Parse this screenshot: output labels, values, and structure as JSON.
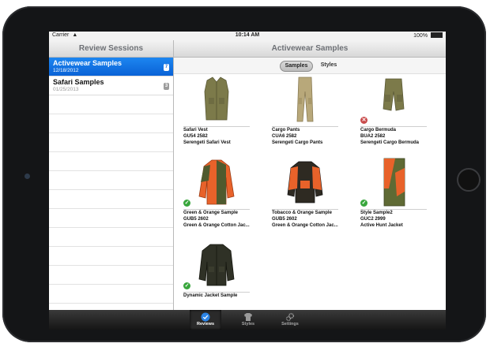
{
  "status": {
    "carrier": "Carrier",
    "time": "10:14 AM",
    "battery": "100%"
  },
  "left_panel": {
    "title": "Review Sessions",
    "sessions": [
      {
        "title": "Activewear Samples",
        "date": "12/18/2012",
        "badge": "7",
        "selected": true
      },
      {
        "title": "Safari Samples",
        "date": "01/25/2013",
        "badge": "3",
        "selected": false
      }
    ]
  },
  "right_panel": {
    "title": "Activewear Samples",
    "segments": [
      {
        "label": "Samples",
        "active": true
      },
      {
        "label": "Styles",
        "active": false
      }
    ],
    "items": [
      {
        "name": "Safari Vest",
        "code": "GU54 2582",
        "desc": "Serengeti Safari Vest",
        "status": "none",
        "image": "vest-icon"
      },
      {
        "name": "Cargo Pants",
        "code": "CUA6 2582",
        "desc": "Serengeti Cargo Pants",
        "status": "none",
        "image": "pants-icon"
      },
      {
        "name": "Cargo Bermuda",
        "code": "BUA2 2582",
        "desc": "Serengeti Cargo Bermuda",
        "status": "rejected",
        "image": "shorts-icon"
      },
      {
        "name": "Green & Orange Sample",
        "code": "GUB5 2602",
        "desc": "Green & Orange Cotton Jac...",
        "status": "approved",
        "image": "jacket-icon"
      },
      {
        "name": "Tobacco & Orange Sample",
        "code": "GUB5 2602",
        "desc": "Green & Orange Cotton Jac...",
        "status": "none",
        "image": "jacket-icon"
      },
      {
        "name": "Style Sample2",
        "code": "GUC2 2999",
        "desc": "Active Hunt Jacket",
        "status": "approved",
        "image": "jacket-icon"
      },
      {
        "name": "Dynamic Jacket Sample",
        "code": "",
        "desc": "",
        "status": "approved",
        "image": "jacket-icon"
      }
    ]
  },
  "tabbar": {
    "tabs": [
      {
        "label": "Reviews",
        "icon": "reviews-icon",
        "active": true
      },
      {
        "label": "Styles",
        "icon": "shirt-icon",
        "active": false
      },
      {
        "label": "Settings",
        "icon": "gears-icon",
        "active": false
      }
    ]
  },
  "colors": {
    "selection": "#0a62d6",
    "approved": "#38a63c",
    "rejected": "#c94b4b",
    "olive": "#7c7a4a",
    "orange": "#e8622a"
  }
}
